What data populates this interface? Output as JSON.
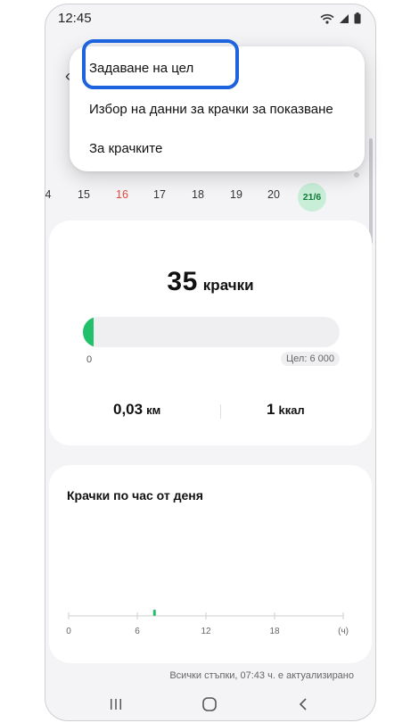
{
  "status_bar": {
    "time": "12:45",
    "icons": [
      "wifi-icon",
      "signal-icon",
      "battery-icon"
    ]
  },
  "date_strip": {
    "days": [
      {
        "label": "4",
        "color": "normal"
      },
      {
        "label": "15",
        "color": "normal"
      },
      {
        "label": "16",
        "color": "red"
      },
      {
        "label": "17",
        "color": "normal"
      },
      {
        "label": "18",
        "color": "normal"
      },
      {
        "label": "19",
        "color": "normal"
      },
      {
        "label": "20",
        "color": "normal"
      },
      {
        "label": "21/6",
        "color": "selected"
      }
    ]
  },
  "menu": {
    "items": [
      {
        "label": "Задаване на цел"
      },
      {
        "label": "Избор на данни за крачки за показване"
      },
      {
        "label": "За крачките"
      }
    ],
    "highlighted_item": "Задаване на цел",
    "highlight_color": "#1c63dd"
  },
  "summary": {
    "steps_value": "35",
    "steps_unit": "крачки",
    "progress_fraction": 0.006,
    "progress_min_label": "0",
    "goal_label": "Цел: 6 000",
    "distance_value": "0,03",
    "distance_unit": "км",
    "calories_value": "1",
    "calories_unit": "kкал"
  },
  "hourly_chart": {
    "title": "Крачки по час от деня",
    "x_tick_labels": [
      "0",
      "6",
      "12",
      "18",
      "(ч)"
    ]
  },
  "chart_data": {
    "type": "bar",
    "title": "Крачки по час от деня",
    "x_ticks": [
      "0",
      "6",
      "12",
      "18"
    ],
    "x_unit": "(ч)",
    "bars": [
      {
        "hour": 7.5,
        "relative_height": 0.35
      }
    ],
    "bar_color": "#21c06b"
  },
  "footer_note": "Всички стъпки, 07:43 ч. е актуализирано",
  "colors": {
    "accent_green": "#21c06b",
    "highlight_blue": "#1c63dd",
    "weekend_red": "#e0493b"
  }
}
